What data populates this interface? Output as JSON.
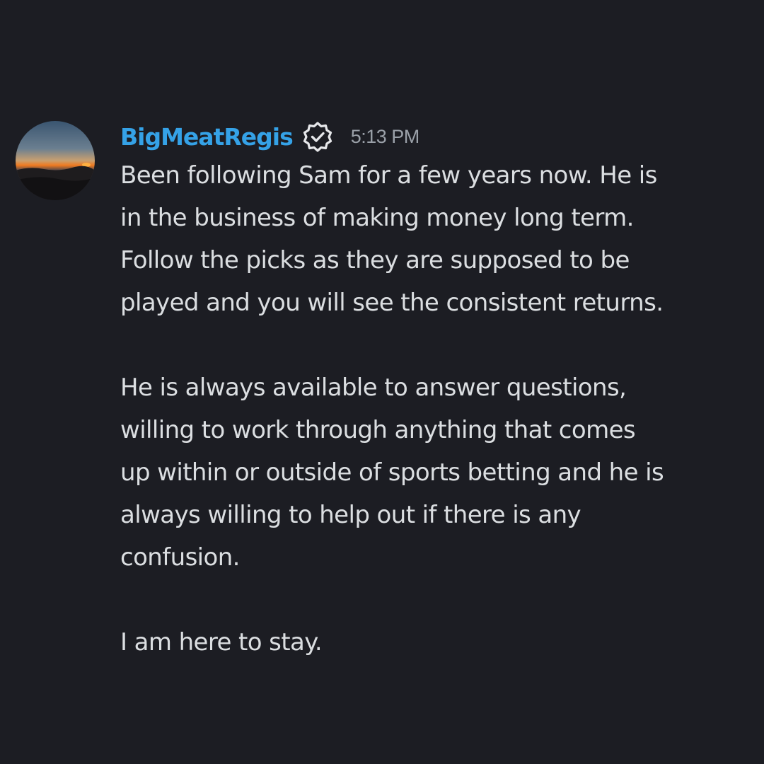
{
  "message": {
    "author": "BigMeatRegis",
    "timestamp": "5:13 PM",
    "badge_icon": "verified-badge-icon",
    "paragraphs": [
      [
        "Been following Sam for a few years now. He is",
        "in the business of making money long term.",
        "Follow the picks as they are supposed to be",
        "played and you will see the consistent returns."
      ],
      [
        "He is always available to answer questions,",
        "willing to work through anything that comes",
        "up within or outside of sports betting and he is",
        "always willing to help out if there is any",
        "confusion."
      ],
      [
        "I am here to stay."
      ]
    ]
  },
  "colors": {
    "background": "#1c1d23",
    "username": "#35a2e7",
    "text": "#dbdee1",
    "timestamp": "#9aa0a8"
  }
}
